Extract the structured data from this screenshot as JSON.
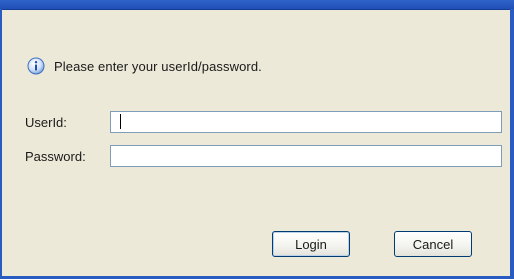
{
  "dialog": {
    "message": "Please enter your userId/password.",
    "info_icon": "info-icon",
    "colors": {
      "frame": "#2a5bc0",
      "background": "#ece9d8",
      "field_border": "#7f9db9",
      "button_border": "#003c74"
    }
  },
  "form": {
    "userid_label": "UserId:",
    "userid_value": "",
    "password_label": "Password:",
    "password_value": ""
  },
  "buttons": {
    "login_label": "Login",
    "cancel_label": "Cancel"
  }
}
